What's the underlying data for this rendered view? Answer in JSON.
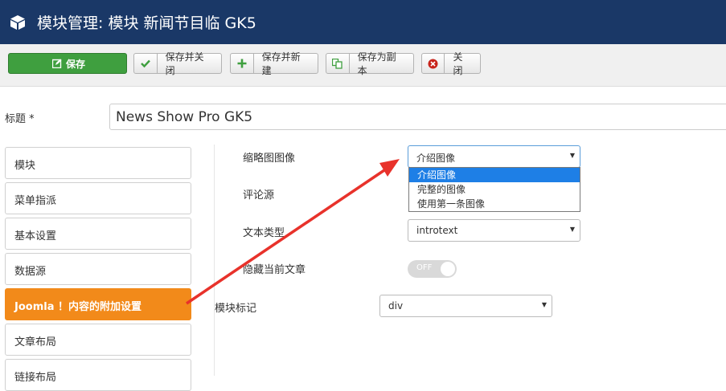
{
  "header": {
    "title": "模块管理: 模块 新闻节目临 GK5",
    "icon": "cube-icon"
  },
  "toolbar": {
    "save": "保存",
    "save_close": "保存并关闭",
    "save_new": "保存并新建",
    "save_copy": "保存为副本",
    "close": "关闭"
  },
  "title_field": {
    "label": "标题 *",
    "value": "News Show Pro GK5"
  },
  "tabs": [
    "模块",
    "菜单指派",
    "基本设置",
    "数据源",
    "Joomla ！内容的附加设置",
    "文章布局",
    "链接布局"
  ],
  "form": {
    "thumb_label": "缩略图图像",
    "thumb_value": "介绍图像",
    "thumb_options": [
      "介绍图像",
      "完整的图像",
      "使用第一条图像"
    ],
    "comment_label": "评论源",
    "text_type_label": "文本类型",
    "text_type_value": "introtext",
    "hide_current_label": "隐藏当前文章",
    "hide_current_value": "OFF",
    "module_tag_label": "模块标记",
    "module_tag_value": "div"
  },
  "colors": {
    "header_bg": "#1a3867",
    "save_green": "#3f9f3f",
    "active_tab": "#f28a1a",
    "annotation_arrow": "#e8322b",
    "selected_option": "#1e7fe6"
  }
}
